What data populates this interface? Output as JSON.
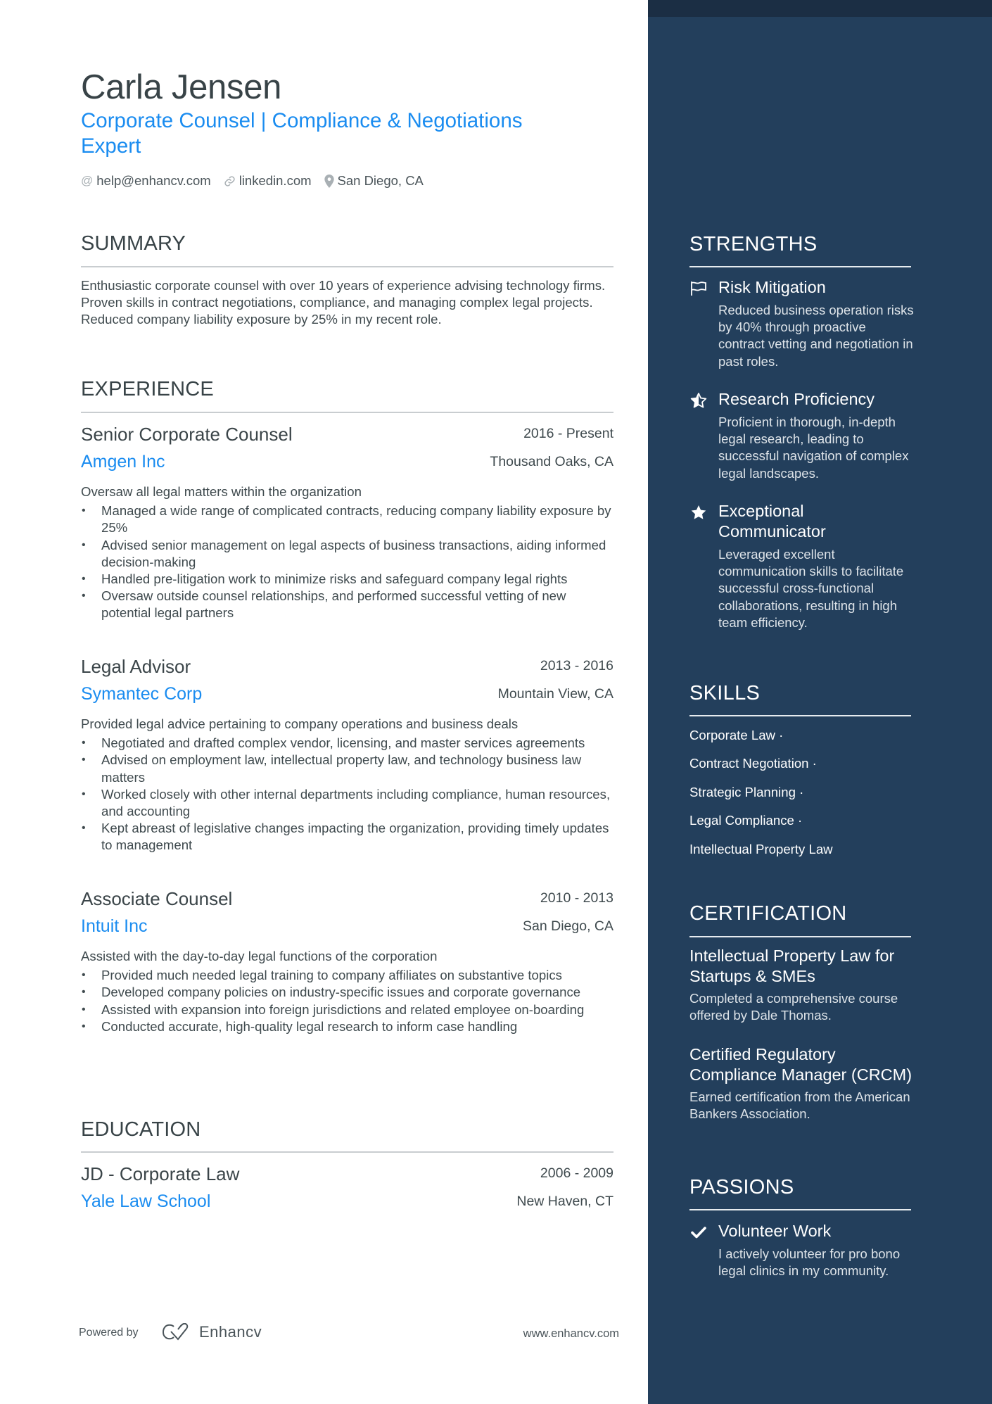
{
  "header": {
    "name": "Carla Jensen",
    "headline": "Corporate Counsel | Compliance & Negotiations Expert",
    "contacts": [
      {
        "icon": "at-icon",
        "text": "help@enhancv.com"
      },
      {
        "icon": "link-icon",
        "text": "linkedin.com"
      },
      {
        "icon": "location-pin-icon",
        "text": "San Diego, CA"
      }
    ]
  },
  "summary": {
    "title": "SUMMARY",
    "text": "Enthusiastic corporate counsel with over 10 years of experience advising technology firms. Proven skills in contract negotiations, compliance, and managing complex legal projects. Reduced company liability exposure by 25% in my recent role."
  },
  "experience": {
    "title": "EXPERIENCE",
    "jobs": [
      {
        "title": "Senior Corporate Counsel",
        "dates": "2016 - Present",
        "company": "Amgen Inc",
        "location": "Thousand Oaks, CA",
        "description": "Oversaw all legal matters within the organization",
        "bullets": [
          "Managed a wide range of complicated contracts, reducing company liability exposure by 25%",
          "Advised senior management on legal aspects of business transactions, aiding informed decision-making",
          "Handled pre-litigation work to minimize risks and safeguard company legal rights",
          "Oversaw outside counsel relationships, and performed successful vetting of new potential legal partners"
        ]
      },
      {
        "title": "Legal Advisor",
        "dates": "2013 - 2016",
        "company": "Symantec Corp",
        "location": "Mountain View, CA",
        "description": "Provided legal advice pertaining to company operations and business deals",
        "bullets": [
          "Negotiated and drafted complex vendor, licensing, and master services agreements",
          "Advised on employment law, intellectual property law, and technology business law matters",
          "Worked closely with other internal departments including compliance, human resources, and accounting",
          "Kept abreast of legislative changes impacting the organization, providing timely updates to management"
        ]
      },
      {
        "title": "Associate Counsel",
        "dates": "2010 - 2013",
        "company": "Intuit Inc",
        "location": "San Diego, CA",
        "description": "Assisted with the day-to-day legal functions of the corporation",
        "bullets": [
          "Provided much needed legal training to company affiliates on substantive topics",
          "Developed company policies on industry-specific issues and corporate governance",
          "Assisted with expansion into foreign jurisdictions and related employee on-boarding",
          "Conducted accurate, high-quality legal research to inform case handling"
        ]
      }
    ]
  },
  "education": {
    "title": "EDUCATION",
    "items": [
      {
        "degree": "JD - Corporate Law",
        "dates": "2006 - 2009",
        "school": "Yale Law School",
        "location": "New Haven, CT"
      }
    ]
  },
  "footer": {
    "powered_by": "Powered by",
    "brand": "Enhancv",
    "website": "www.enhancv.com"
  },
  "sidebar": {
    "strengths": {
      "title": "STRENGTHS",
      "items": [
        {
          "icon": "flag-icon",
          "title": "Risk Mitigation",
          "description": "Reduced business operation risks by 40% through proactive contract vetting and negotiation in past roles."
        },
        {
          "icon": "half-star-icon",
          "title": "Research Proficiency",
          "description": "Proficient in thorough, in-depth legal research, leading to successful navigation of complex legal landscapes."
        },
        {
          "icon": "star-icon",
          "title": "Exceptional Communicator",
          "description": "Leveraged excellent communication skills to facilitate successful cross-functional collaborations, resulting in high team efficiency."
        }
      ]
    },
    "skills": {
      "title": "SKILLS",
      "items": [
        "Corporate Law ·",
        "Contract Negotiation ·",
        "Strategic Planning ·",
        "Legal Compliance ·",
        "Intellectual Property Law"
      ]
    },
    "certification": {
      "title": "CERTIFICATION",
      "items": [
        {
          "title": "Intellectual Property Law for Startups & SMEs",
          "description": "Completed a comprehensive course offered by Dale Thomas."
        },
        {
          "title": "Certified Regulatory Compliance Manager (CRCM)",
          "description": "Earned certification from the American Bankers Association."
        }
      ]
    },
    "passions": {
      "title": "PASSIONS",
      "items": [
        {
          "icon": "check-icon",
          "title": "Volunteer Work",
          "description": "I actively volunteer for pro bono legal clinics in my community."
        }
      ]
    }
  },
  "colors": {
    "accent": "#1a8cf0",
    "sidebar_bg": "#233f5c",
    "sidebar_band": "#1b2e44",
    "text": "#384347"
  }
}
